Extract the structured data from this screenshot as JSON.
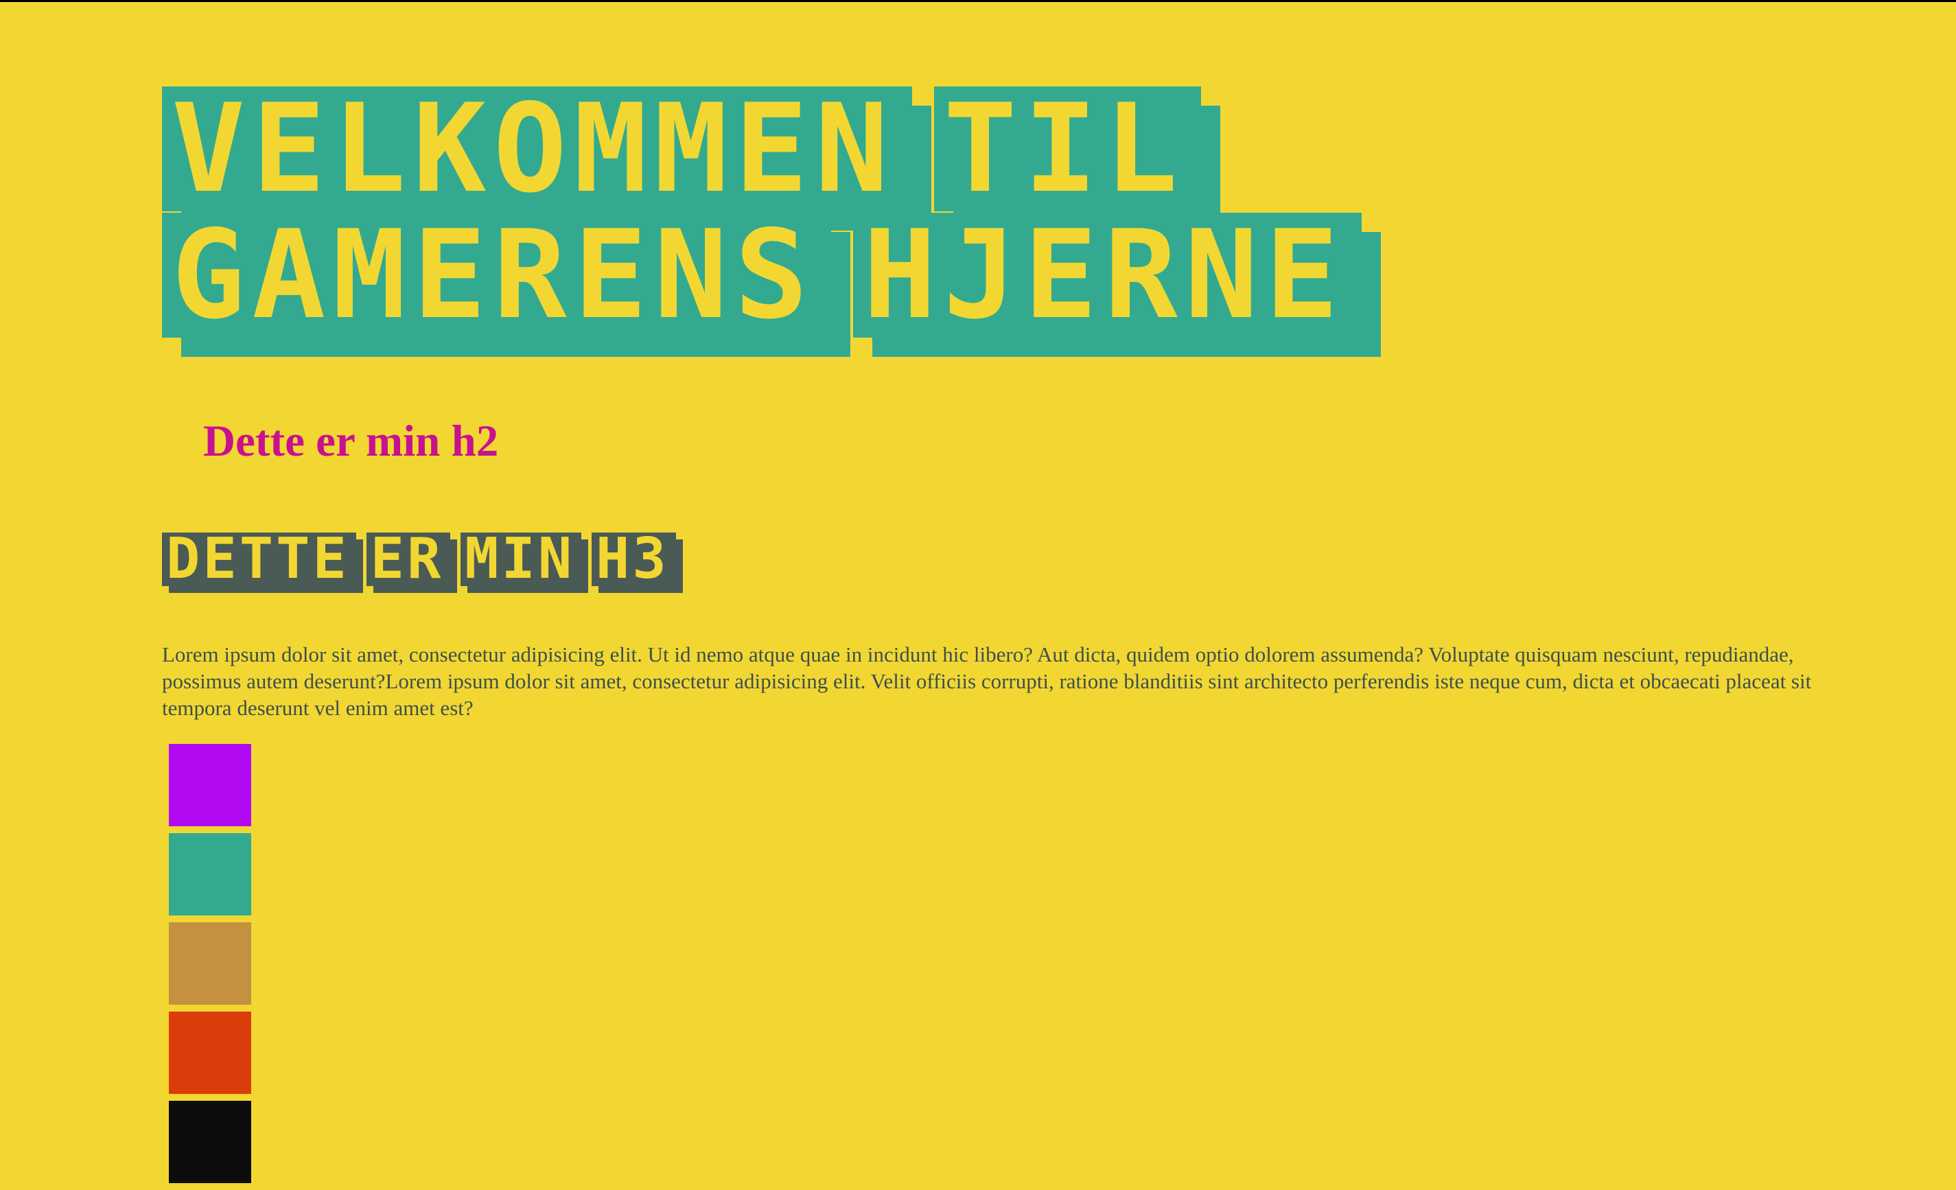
{
  "page": {
    "h1_words": [
      "Velkommen",
      "til",
      "gamerens",
      "hjerne"
    ],
    "h2": "Dette er min h2",
    "h3_words": [
      "Dette",
      "er",
      "min",
      "h3"
    ],
    "paragraph": "Lorem ipsum dolor sit amet, consectetur adipisicing elit. Ut id nemo atque quae in incidunt hic libero? Aut dicta, quidem optio dolorem assumenda? Voluptate quisquam nesciunt, repudiandae, possimus autem deserunt?Lorem ipsum dolor sit amet, consectetur adipisicing elit. Velit officiis corrupti, ratione blanditiis sint architecto perferendis iste neque cum, dicta et obcaecati placeat sit tempora deserunt vel enim amet est?"
  },
  "colors": {
    "background": "#f2d733",
    "h1_block": "#33aa90",
    "h2_text": "#c8118f",
    "h3_block": "#4a5a55",
    "paragraph_text": "#3d4f4d"
  },
  "swatches": [
    {
      "name": "purple",
      "color": "#b20af2"
    },
    {
      "name": "teal",
      "color": "#33aa90"
    },
    {
      "name": "ochre",
      "color": "#c39140"
    },
    {
      "name": "orange-red",
      "color": "#db3d0a"
    },
    {
      "name": "black",
      "color": "#0d0d0d"
    }
  ]
}
